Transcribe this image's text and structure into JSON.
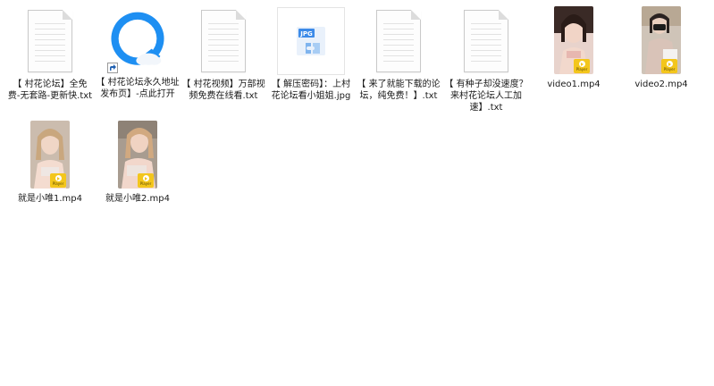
{
  "files": [
    {
      "name": "【 村花论坛】全免费-无套路-更新快.txt",
      "type": "txt"
    },
    {
      "name": "【 村花论坛永久地址发布页】-点此打开",
      "type": "shortcut"
    },
    {
      "name": "【 村花视频】万部视频免费在线看.txt",
      "type": "txt"
    },
    {
      "name": "【 解压密码】：上村花论坛看小姐姐.jpg",
      "type": "jpg",
      "thumb_text": "JPG"
    },
    {
      "name": "【 来了就能下载的论坛，纯免费！】.txt",
      "type": "txt"
    },
    {
      "name": "【 有种子却没速度？来村花论坛人工加速】.txt",
      "type": "txt"
    },
    {
      "name": "video1.mp4",
      "type": "mp4"
    },
    {
      "name": "video2.mp4",
      "type": "mp4"
    },
    {
      "name": "就是小唯1.mp4",
      "type": "mp4"
    },
    {
      "name": "就是小唯2.mp4",
      "type": "mp4"
    }
  ],
  "player_badge_text": "Player",
  "colors": {
    "background": "#ffffff",
    "badge": "#f3c61c",
    "browser_icon_blue": "#1e8ff2"
  }
}
